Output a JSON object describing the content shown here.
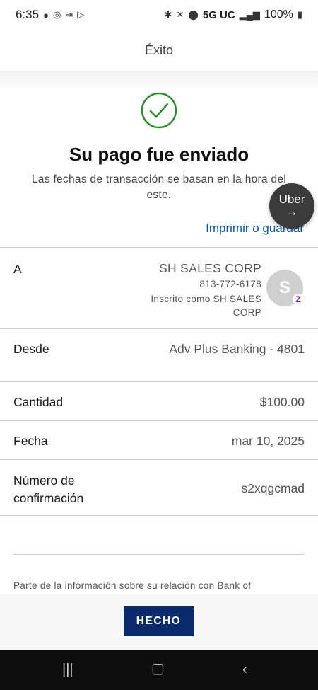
{
  "status_bar": {
    "time": "6:35",
    "network": "5G UC",
    "battery": "100%"
  },
  "header": {
    "title": "Éxito"
  },
  "success": {
    "title": "Su pago fue enviado",
    "subtitle": "Las fechas de transacción se basan en la hora del este.",
    "print_link": "Imprimir o guardar"
  },
  "uber_bubble": {
    "label": "Uber",
    "arrow": "→"
  },
  "details": {
    "to": {
      "label": "A",
      "name": "SH SALES CORP",
      "phone": "813-772-6178",
      "enrolled": "Inscrito como SH SALES CORP",
      "avatar_initial": "S",
      "badge": "Z"
    },
    "from": {
      "label": "Desde",
      "value": "Adv Plus Banking - 4801"
    },
    "amount": {
      "label": "Cantidad",
      "value": "$100.00"
    },
    "date": {
      "label": "Fecha",
      "value": "mar 10, 2025"
    },
    "confirmation": {
      "label_line1": "Número de",
      "label_line2": "confirmación",
      "value": "s2xqgcmad"
    }
  },
  "footer_note": "Parte de la información sobre su relación con Bank of",
  "done_button": "HECHO",
  "colors": {
    "accent_link": "#0a56a5",
    "button_bg": "#0b2a6b",
    "check_green": "#2e8b2e"
  }
}
